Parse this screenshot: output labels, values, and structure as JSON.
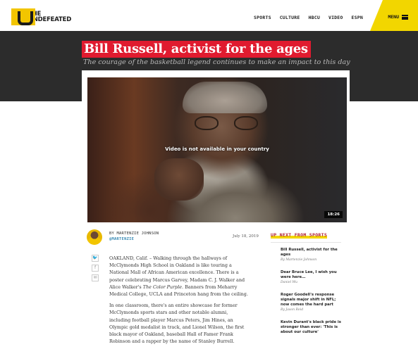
{
  "header": {
    "logo_line1": "THE",
    "logo_line2": "UNDEFEATED",
    "nav": [
      "SPORTS",
      "CULTURE",
      "HBCU",
      "VIDEO",
      "ESPN"
    ],
    "menu_label": "MENU"
  },
  "hero": {
    "headline": "Bill Russell, activist for the ages",
    "subhead": "The courage of the basketball legend continues to make an impact to this day"
  },
  "video": {
    "message": "Video is not available in your country",
    "duration": "18:26"
  },
  "byline": {
    "by": "BY MARTENZIE JOHNSON",
    "handle": "@MARTENZIE",
    "date": "July 18, 2019"
  },
  "share": {
    "icons": [
      "twitter-icon",
      "facebook-icon",
      "email-icon"
    ],
    "twitter_glyph": "🐦",
    "facebook_glyph": "f",
    "email_glyph": "✉"
  },
  "article": {
    "p1_a": "OAKLAND, Calif. – Walking through the hallways of McClymonds High School in Oakland is like touring a National Mall of African American excellence. There is a poster celebrating Marcus Garvey, Madam C. J. Walker and Alice Walker's ",
    "p1_em": "The Color Purple",
    "p1_b": ". Banners from Meharry Medical College, UCLA and Princeton hang from the ceiling.",
    "p2": "In one classroom, there's an entire showcase for former McClymonds sports stars and other notable alumni, including football player Marcus Peters, Jim Hines, an Olympic gold medalist in track, and Lionel Wilson, the first black mayor of Oakland, baseball Hall of Famer Frank Robinson and a rapper by the name of Stanley Burrell."
  },
  "sidebar": {
    "heading": "UP NEXT FROM SPORTS",
    "items": [
      {
        "title": "Bill Russell, activist for the ages",
        "author": "By Martenzie Johnson"
      },
      {
        "title": "Dear Bruce Lee, I wish you were here…",
        "author": "Daniel Wu"
      },
      {
        "title": "Roger Goodell's response signals major shift in NFL; now comes the hard part",
        "author": "By Jason Reid"
      },
      {
        "title": "Kevin Durant's black pride is stronger than ever: 'This is about our culture'",
        "author": ""
      }
    ]
  },
  "colors": {
    "brand_yellow": "#f2d600",
    "headline_red": "#e01b2f",
    "hero_bg": "#2c2c2c",
    "link_blue": "#3a8bb5"
  }
}
